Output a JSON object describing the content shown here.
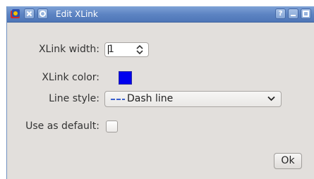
{
  "window": {
    "title": "Edit XLink",
    "help_glyph": "?",
    "minimize_glyph": "_",
    "titlebar_color": "#5d84c3"
  },
  "form": {
    "width_label": "XLink width:",
    "width_value": "1",
    "color_label": "XLink color:",
    "color_value": "#0000ee",
    "line_style_label": "Line style:",
    "line_style_value": "Dash line",
    "default_label": "Use as default:",
    "default_checked": false
  },
  "buttons": {
    "ok_label": "Ok"
  },
  "icons": {
    "app": "app-icon",
    "close": "close-icon",
    "menu": "window-menu-icon",
    "help": "help-icon",
    "minimize": "minimize-icon",
    "maximize": "maximize-icon",
    "spin": "spin-arrows-icon",
    "dropdown": "chevron-down-icon"
  }
}
